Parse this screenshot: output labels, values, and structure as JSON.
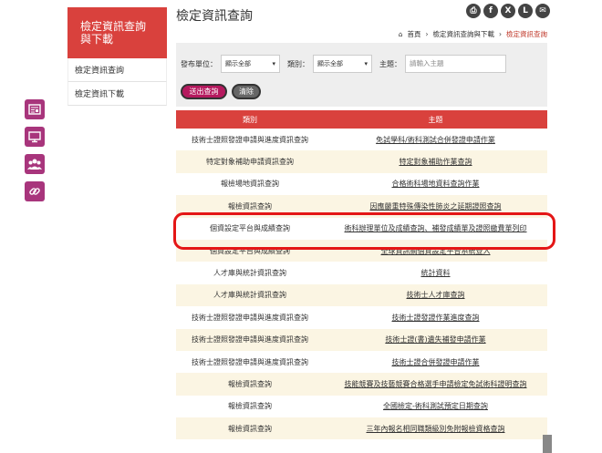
{
  "page": {
    "title": "檢定資訊查詢"
  },
  "sidebar": {
    "heading": "檢定資訊查詢與下載",
    "items": [
      {
        "label": "檢定資訊查詢"
      },
      {
        "label": "檢定資訊下載"
      }
    ]
  },
  "float_icons": [
    "news-icon",
    "monitor-icon",
    "people-icon",
    "link-icon"
  ],
  "social": [
    {
      "icon": "print-icon",
      "glyph": "⎙"
    },
    {
      "icon": "facebook-icon",
      "glyph": "f"
    },
    {
      "icon": "x-icon",
      "glyph": "X"
    },
    {
      "icon": "line-icon",
      "glyph": "L"
    },
    {
      "icon": "email-icon",
      "glyph": "✉"
    }
  ],
  "breadcrumb": {
    "home": "首頁",
    "sep": "›",
    "parent": "檢定資訊查詢與下載",
    "current": "檢定資訊查詢"
  },
  "filter": {
    "unit_label": "發布單位：",
    "unit_value": "顯示全部",
    "category_label": "類別：",
    "category_value": "顯示全部",
    "topic_label": "主題：",
    "topic_placeholder": "請輸入主題",
    "submit_label": "送出查詢",
    "clear_label": "清除"
  },
  "table": {
    "headers": [
      "類別",
      "主題"
    ],
    "rows": [
      {
        "category": "技術士證照發證申請與進度資訊查詢",
        "topic": "免試學科/術科測試合併發證申請作業"
      },
      {
        "category": "特定對象補助申請資訊查詢",
        "topic": "特定對象補助作業查詢"
      },
      {
        "category": "報檢場地資訊查詢",
        "topic": "合格術科場地資料查詢作業"
      },
      {
        "category": "報檢資訊查詢",
        "topic": "因應嚴重特殊傳染性肺炎之延期證照查詢"
      },
      {
        "category": "個資設定平台與成績查詢",
        "topic": "術科辦理單位及成績查詢、補發成績單及證照繳費單列印"
      },
      {
        "category": "個資設定平台與成績查詢",
        "topic": "全球資訊網個資設定平台系統登入"
      },
      {
        "category": "人才庫與統計資訊查詢",
        "topic": "統計資料"
      },
      {
        "category": "人才庫與統計資訊查詢",
        "topic": "技術士人才庫查詢"
      },
      {
        "category": "技術士證照發證申請與進度資訊查詢",
        "topic": "技術士證發證作業進度查詢"
      },
      {
        "category": "技術士證照發證申請與進度資訊查詢",
        "topic": "技術士證(書)遺失補發申請作業"
      },
      {
        "category": "技術士證照發證申請與進度資訊查詢",
        "topic": "技術士證合併發證申請作業"
      },
      {
        "category": "報檢資訊查詢",
        "topic": "技能競賽及技藝競賽合格選手申請檢定免試術科證明查詢"
      },
      {
        "category": "報檢資訊查詢",
        "topic": "全國檢定-術科測試預定日期查詢"
      },
      {
        "category": "報檢資訊查詢",
        "topic": "三年內報名相同職類級別免附報檢資格查詢"
      }
    ]
  }
}
